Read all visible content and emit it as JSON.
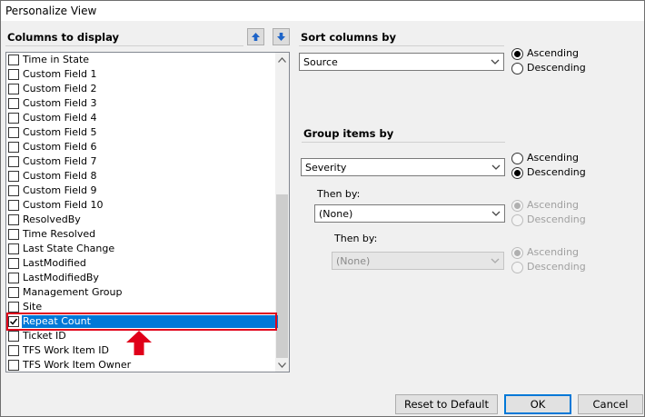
{
  "window": {
    "title": "Personalize View"
  },
  "columns": {
    "header": "Columns to display",
    "items": [
      {
        "label": "Time in State",
        "checked": false,
        "selected": false
      },
      {
        "label": "Custom Field 1",
        "checked": false,
        "selected": false
      },
      {
        "label": "Custom Field 2",
        "checked": false,
        "selected": false
      },
      {
        "label": "Custom Field 3",
        "checked": false,
        "selected": false
      },
      {
        "label": "Custom Field 4",
        "checked": false,
        "selected": false
      },
      {
        "label": "Custom Field 5",
        "checked": false,
        "selected": false
      },
      {
        "label": "Custom Field 6",
        "checked": false,
        "selected": false
      },
      {
        "label": "Custom Field 7",
        "checked": false,
        "selected": false
      },
      {
        "label": "Custom Field 8",
        "checked": false,
        "selected": false
      },
      {
        "label": "Custom Field 9",
        "checked": false,
        "selected": false
      },
      {
        "label": "Custom Field 10",
        "checked": false,
        "selected": false
      },
      {
        "label": "ResolvedBy",
        "checked": false,
        "selected": false
      },
      {
        "label": "Time Resolved",
        "checked": false,
        "selected": false
      },
      {
        "label": "Last State Change",
        "checked": false,
        "selected": false
      },
      {
        "label": "LastModified",
        "checked": false,
        "selected": false
      },
      {
        "label": "LastModifiedBy",
        "checked": false,
        "selected": false
      },
      {
        "label": "Management Group",
        "checked": false,
        "selected": false
      },
      {
        "label": "Site",
        "checked": false,
        "selected": false
      },
      {
        "label": "Repeat Count",
        "checked": true,
        "selected": true
      },
      {
        "label": "Ticket ID",
        "checked": false,
        "selected": false
      },
      {
        "label": "TFS Work Item ID",
        "checked": false,
        "selected": false
      },
      {
        "label": "TFS Work Item Owner",
        "checked": false,
        "selected": false
      }
    ]
  },
  "sort": {
    "header": "Sort columns by",
    "value": "Source",
    "ascending": "Ascending",
    "descending": "Descending"
  },
  "group": {
    "header": "Group items by",
    "value": "Severity",
    "ascending": "Ascending",
    "descending": "Descending",
    "then1": {
      "label": "Then by:",
      "value": "(None)",
      "ascending": "Ascending",
      "descending": "Descending"
    },
    "then2": {
      "label": "Then by:",
      "value": "(None)",
      "ascending": "Ascending",
      "descending": "Descending"
    }
  },
  "buttons": {
    "reset": "Reset to Default",
    "ok": "OK",
    "cancel": "Cancel"
  },
  "colors": {
    "selection": "#0078d7",
    "highlight": "#e0001a",
    "arrow_button": "#1e64c8"
  }
}
